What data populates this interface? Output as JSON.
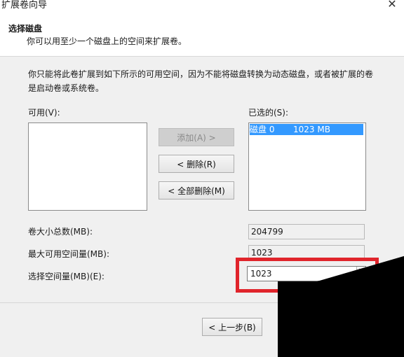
{
  "window": {
    "title": "扩展卷向导",
    "close_icon": "close-icon"
  },
  "header": {
    "title": "选择磁盘",
    "subtitle": "你可以用至少一个磁盘上的空间来扩展卷。"
  },
  "description": "你只能将此卷扩展到如下所示的可用空间，因为不能将磁盘转换为动态磁盘，或者被扩展的卷是启动卷或系统卷。",
  "available": {
    "label": "可用(V):",
    "items": []
  },
  "selected": {
    "label": "已选的(S):",
    "items": [
      {
        "disk": "磁盘 0",
        "size": "1023 MB"
      }
    ]
  },
  "buttons": {
    "add": "添加(A) >",
    "remove": "< 删除(R)",
    "remove_all": "< 全部删除(M)",
    "back": "< 上一步(B)"
  },
  "fields": {
    "total_label": "卷大小总数(MB):",
    "total_value": "204799",
    "max_label": "最大可用空间量(MB):",
    "max_value": "1023",
    "select_label": "选择空间量(MB)(E):",
    "select_value": "1023"
  },
  "colors": {
    "highlight": "#e0242b",
    "selection": "#3399ff"
  }
}
